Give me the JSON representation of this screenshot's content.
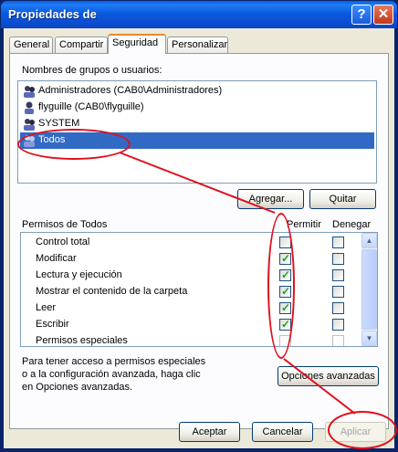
{
  "window": {
    "title": "Propiedades de"
  },
  "title_buttons": {
    "help": "?",
    "close": "✕"
  },
  "tabs": [
    {
      "label": "General"
    },
    {
      "label": "Compartir"
    },
    {
      "label": "Seguridad"
    },
    {
      "label": "Personalizar"
    }
  ],
  "users_section": {
    "label": "Nombres de grupos o usuarios:",
    "users": [
      {
        "name": "Administradores (CAB0\\Administradores)",
        "icon": "group-icon"
      },
      {
        "name": "flyguille (CAB0\\flyguille)",
        "icon": "user-icon"
      },
      {
        "name": "SYSTEM",
        "icon": "group-icon"
      },
      {
        "name": "Todos",
        "icon": "group-icon",
        "selected": true
      }
    ],
    "add_button": "Agregar...",
    "remove_button": "Quitar"
  },
  "permissions": {
    "label": "Permisos de Todos",
    "col_allow": "Permitir",
    "col_deny": "Denegar",
    "rows": [
      {
        "name": "Control total",
        "allow": false,
        "deny": false
      },
      {
        "name": "Modificar",
        "allow": true,
        "deny": false
      },
      {
        "name": "Lectura y ejecución",
        "allow": true,
        "deny": false
      },
      {
        "name": "Mostrar el contenido de la carpeta",
        "allow": true,
        "deny": false
      },
      {
        "name": "Leer",
        "allow": true,
        "deny": false
      },
      {
        "name": "Escribir",
        "allow": true,
        "deny": false
      },
      {
        "name": "Permisos especiales",
        "allow": false,
        "deny": false,
        "disabled": true
      }
    ]
  },
  "advanced": {
    "text_lines": [
      "Para tener acceso a permisos especiales",
      "o a la configuración avanzada, haga clic",
      "en Opciones avanzadas."
    ],
    "button": "Opciones avanzadas"
  },
  "footer": {
    "ok": "Aceptar",
    "cancel": "Cancelar",
    "apply": "Aplicar"
  },
  "colors": {
    "annotation": "#e0101c",
    "selection": "#316ac5",
    "titlebar": "#0a5ae0"
  }
}
